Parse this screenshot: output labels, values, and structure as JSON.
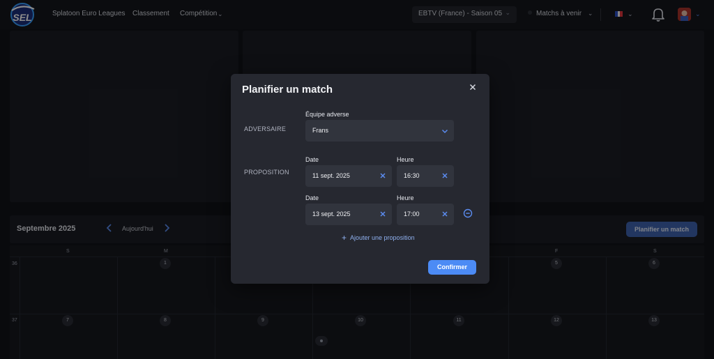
{
  "nav": {
    "logo_text": "SEL",
    "links": [
      "Splatoon Euro Leagues",
      "Classement",
      "Compétition"
    ],
    "season_select": "EBTV (France) - Saison 05",
    "upcoming_label": "Matchs à venir"
  },
  "calendar": {
    "month_title": "Septembre 2025",
    "today_label": "Aujourd'hui",
    "plan_button": "Planifier un match",
    "day_headers": [
      "S",
      "M",
      "",
      "",
      "",
      "F",
      "S"
    ],
    "weeks": [
      {
        "number": "36",
        "days": [
          "",
          "1",
          "",
          "",
          "",
          "5",
          "6"
        ]
      },
      {
        "number": "37",
        "days": [
          "7",
          "8",
          "9",
          "10",
          "11",
          "12",
          "13"
        ]
      }
    ]
  },
  "modal": {
    "title": "Planifier un match",
    "adversaire_label": "ADVERSAIRE",
    "proposition_label": "PROPOSITION",
    "opponent_field_label": "Équipe adverse",
    "opponent_value": "Frans",
    "date_label": "Date",
    "time_label": "Heure",
    "proposals": [
      {
        "date": "11 sept. 2025",
        "time": "16:30"
      },
      {
        "date": "13 sept. 2025",
        "time": "17:00"
      }
    ],
    "add_proposal": "Ajouter une proposition",
    "confirm": "Confirmer"
  },
  "colors": {
    "accent": "#4c8bf5",
    "modal_bg": "#262830",
    "field_bg": "#31343d",
    "page_bg": "#111318"
  }
}
